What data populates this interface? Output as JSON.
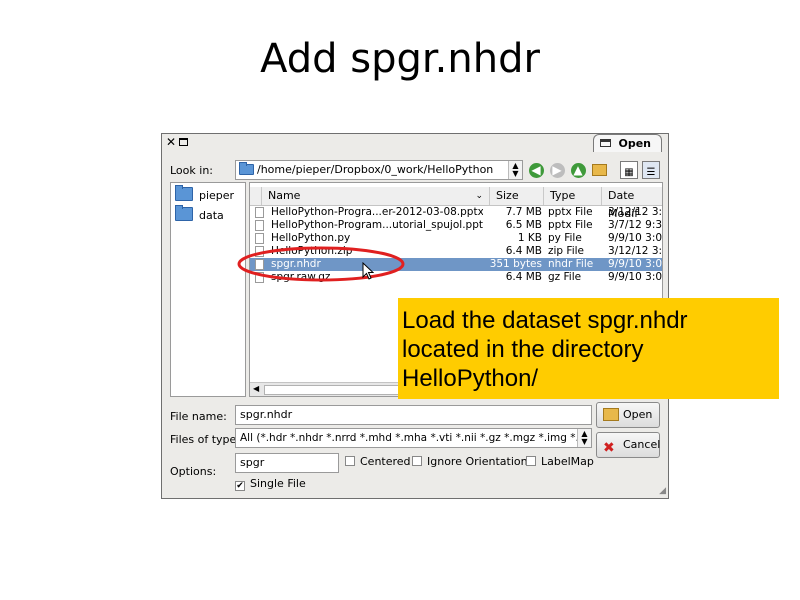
{
  "slide": {
    "title": "Add spgr.nhdr"
  },
  "dialog": {
    "close_glyph": "✕",
    "window_tab": "Open",
    "look_in_label": "Look in:",
    "path": "/home/pieper/Dropbox/0_work/HelloPython",
    "sidebar": [
      {
        "label": "pieper",
        "icon": "folder-icon"
      },
      {
        "label": "data",
        "icon": "folder-icon"
      }
    ],
    "columns": {
      "name": "Name",
      "size": "Size",
      "type": "Type",
      "date": "Date Modif"
    },
    "files": [
      {
        "name": "HelloPython-Progra...er-2012-03-08.pptx",
        "size": "7.7 MB",
        "type": "pptx File",
        "date": "3/12/12 3:"
      },
      {
        "name": "HelloPython-Program...utorial_spujol.pptx",
        "size": "6.5 MB",
        "type": "pptx File",
        "date": "3/7/12 9:3"
      },
      {
        "name": "HelloPython.py",
        "size": "1 KB",
        "type": "py File",
        "date": "9/9/10 3:0"
      },
      {
        "name": "HelloPython.zip",
        "size": "6.4 MB",
        "type": "zip File",
        "date": "3/12/12 3:"
      },
      {
        "name": "spgr.nhdr",
        "size": "351 bytes",
        "type": "nhdr File",
        "date": "9/9/10 3:0",
        "selected": true
      },
      {
        "name": "spgr.raw.gz",
        "size": "6.4 MB",
        "type": "gz File",
        "date": "9/9/10 3:0"
      }
    ],
    "file_name_label": "File name:",
    "file_name_value": "spgr.nhdr",
    "files_of_type_label": "Files of type:",
    "files_of_type_value": "All (*.hdr *.nhdr *.nrrd *.mhd *.mha *.vti *.nii *.gz *.mgz *.img *.p",
    "options_label": "Options:",
    "options_value": "spgr",
    "checkboxes": [
      {
        "label": "Centered",
        "checked": false
      },
      {
        "label": "Ignore Orientation",
        "checked": false
      },
      {
        "label": "LabelMap",
        "checked": false
      },
      {
        "label": "Single File",
        "checked": true
      }
    ],
    "open_button": "Open",
    "cancel_button": "Cancel",
    "check_glyph": "✔"
  },
  "callout": {
    "lines": [
      "Load the dataset spgr.nhdr",
      "located in the directory",
      "HelloPython/"
    ]
  },
  "colors": {
    "callout_bg": "#ffcc00",
    "annotation_oval": "#e02020",
    "selection": "#6f96c6"
  }
}
